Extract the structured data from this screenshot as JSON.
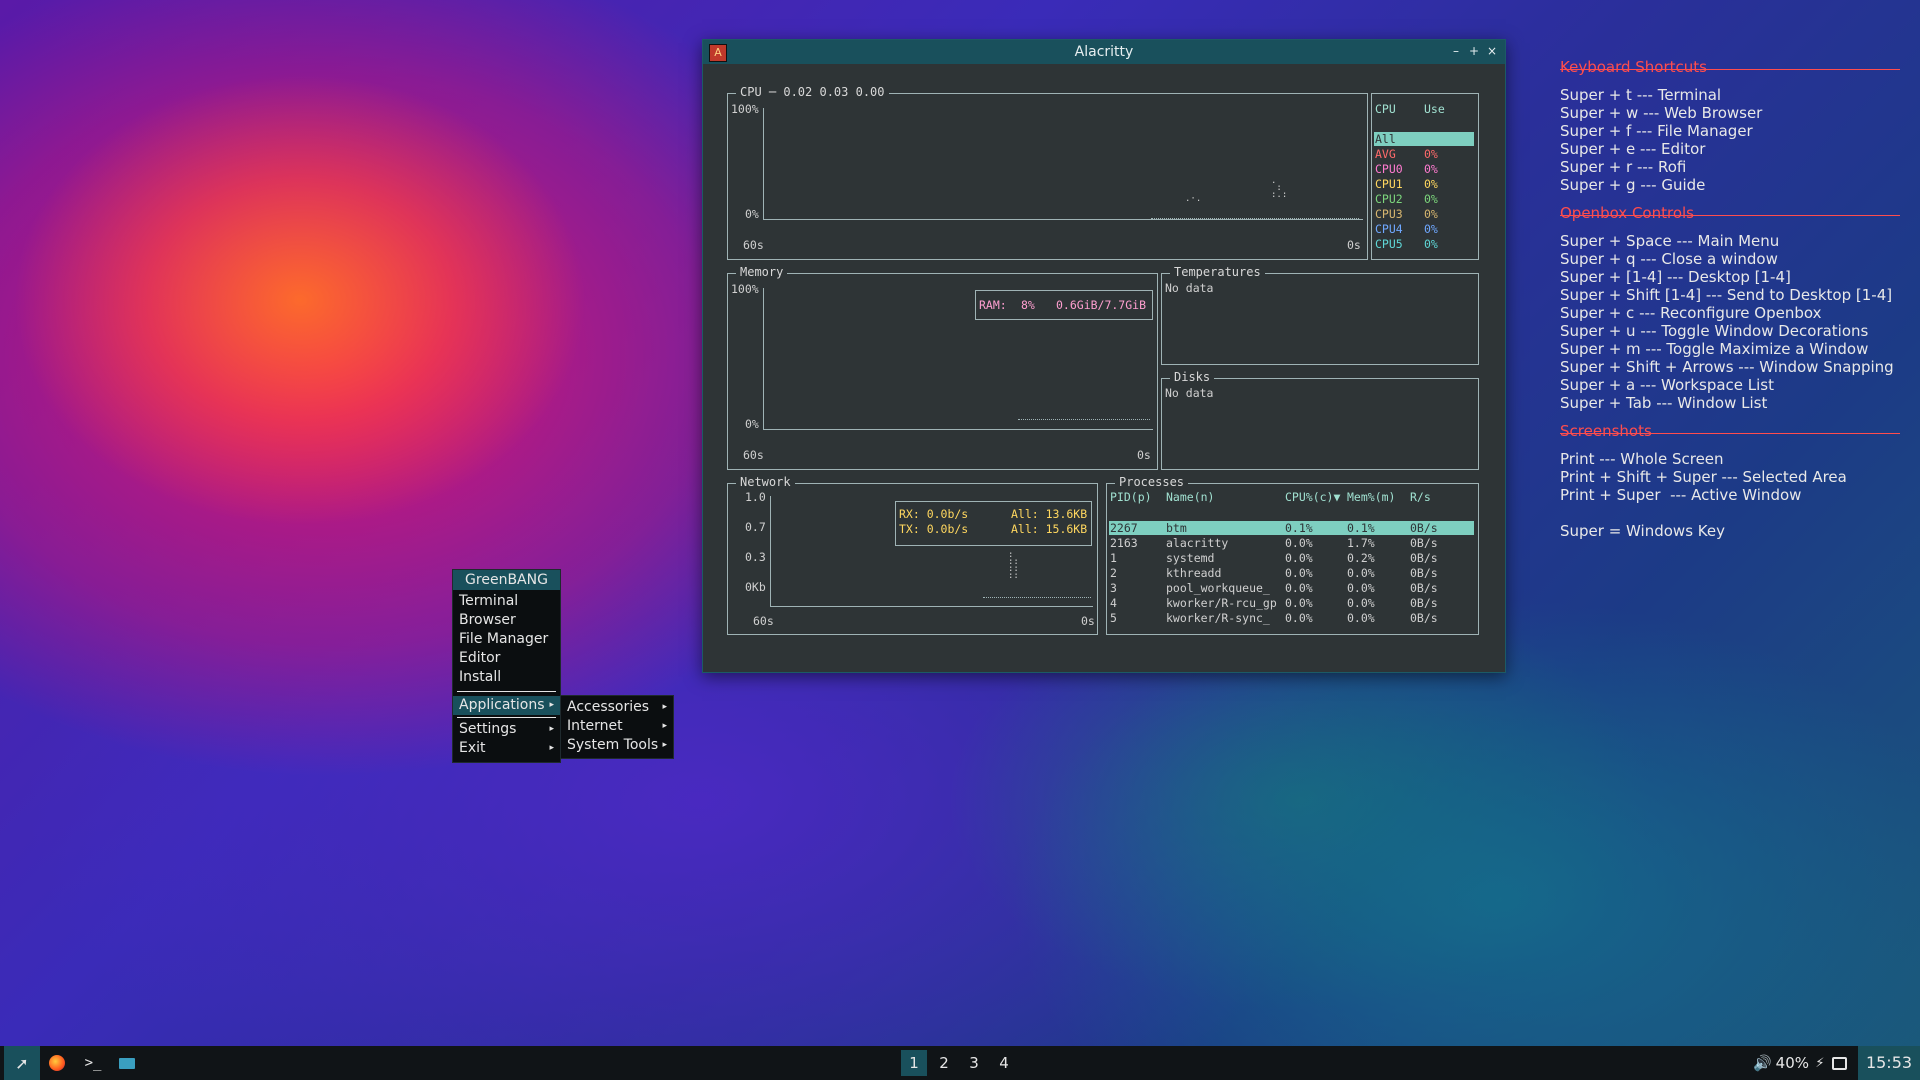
{
  "window": {
    "title": "Alacritty"
  },
  "btm": {
    "cpu": {
      "title": "CPU ─ 0.02 0.03 0.00",
      "y_top": "100%",
      "y_bottom": "0%",
      "x_left": "60s",
      "x_right": "0s",
      "list_headers": [
        "CPU",
        "Use"
      ],
      "rows": [
        {
          "name": "All",
          "use": "",
          "color": "#a0e0d0"
        },
        {
          "name": "AVG",
          "use": "0%",
          "color": "#ff6a6a"
        },
        {
          "name": "CPU0",
          "use": "0%",
          "color": "#ff7bd0"
        },
        {
          "name": "CPU1",
          "use": "0%",
          "color": "#ffd75f"
        },
        {
          "name": "CPU2",
          "use": "0%",
          "color": "#7cd67c"
        },
        {
          "name": "CPU3",
          "use": "0%",
          "color": "#d7b66f"
        },
        {
          "name": "CPU4",
          "use": "0%",
          "color": "#6fa8ff"
        },
        {
          "name": "CPU5",
          "use": "0%",
          "color": "#5fd7d7"
        }
      ]
    },
    "memory": {
      "title": "Memory",
      "y_top": "100%",
      "y_bottom": "0%",
      "x_left": "60s",
      "x_right": "0s",
      "ram_label": "RAM:",
      "ram_pct": "8%",
      "ram_val": "0.6GiB/7.7GiB"
    },
    "temps": {
      "title": "Temperatures",
      "value": "No data"
    },
    "disks": {
      "title": "Disks",
      "value": "No data"
    },
    "network": {
      "title": "Network",
      "y_ticks": [
        "1.0",
        "0.7",
        "0.3",
        "0Kb"
      ],
      "x_left": "60s",
      "x_right": "0s",
      "rx": "RX: 0.0b/s",
      "rx_all": "All: 13.6KB",
      "tx": "TX: 0.0b/s",
      "tx_all": "All: 15.6KB"
    },
    "processes": {
      "title": "Processes",
      "headers": [
        "PID(p)",
        "Name(n)",
        "CPU%(c)▼",
        "Mem%(m)",
        "R/s"
      ],
      "rows": [
        [
          "2267",
          "btm",
          "0.1%",
          "0.1%",
          "0B/s"
        ],
        [
          "2163",
          "alacritty",
          "0.0%",
          "1.7%",
          "0B/s"
        ],
        [
          "1",
          "systemd",
          "0.0%",
          "0.2%",
          "0B/s"
        ],
        [
          "2",
          "kthreadd",
          "0.0%",
          "0.0%",
          "0B/s"
        ],
        [
          "3",
          "pool_workqueue_",
          "0.0%",
          "0.0%",
          "0B/s"
        ],
        [
          "4",
          "kworker/R-rcu_gp",
          "0.0%",
          "0.0%",
          "0B/s"
        ],
        [
          "5",
          "kworker/R-sync_",
          "0.0%",
          "0.0%",
          "0B/s"
        ]
      ]
    }
  },
  "menu": {
    "title": "GreenBANG",
    "items": [
      "Terminal",
      "Browser",
      "File Manager",
      "Editor",
      "Install"
    ],
    "applications": "Applications",
    "settings": "Settings",
    "exit": "Exit",
    "submenu": [
      "Accessories",
      "Internet",
      "System Tools"
    ]
  },
  "shortcuts": {
    "keyboard_title": "Keyboard Shortcuts",
    "keyboard": [
      "Super + t --- Terminal",
      "Super + w --- Web Browser",
      "Super + f --- File Manager",
      "Super + e --- Editor",
      "Super + r --- Rofi",
      "Super + g --- Guide"
    ],
    "openbox_title": "Openbox Controls",
    "openbox": [
      "Super + Space --- Main Menu",
      "Super + q --- Close a window",
      "Super + [1-4] --- Desktop [1-4]",
      "Super + Shift [1-4] --- Send to Desktop [1-4]",
      "Super + c --- Reconfigure Openbox",
      "Super + u --- Toggle Window Decorations",
      "Super + m --- Toggle Maximize a Window",
      "Super + Shift + Arrows --- Window Snapping",
      "Super + a --- Workspace List",
      "Super + Tab --- Window List"
    ],
    "screenshots_title": "Screenshots",
    "screenshots": [
      "Print --- Whole Screen",
      "Print + Shift + Super --- Selected Area",
      "Print + Super  --- Active Window"
    ],
    "note": "Super = Windows Key"
  },
  "taskbar": {
    "workspaces": [
      "1",
      "2",
      "3",
      "4"
    ],
    "active_workspace": "1",
    "volume": "40%",
    "clock": "15:53",
    "icons": [
      "launcher-rocket-icon",
      "firefox-icon",
      "terminal-icon",
      "folder-icon",
      "volume-icon",
      "battery-charging-icon",
      "screen-icon"
    ]
  }
}
